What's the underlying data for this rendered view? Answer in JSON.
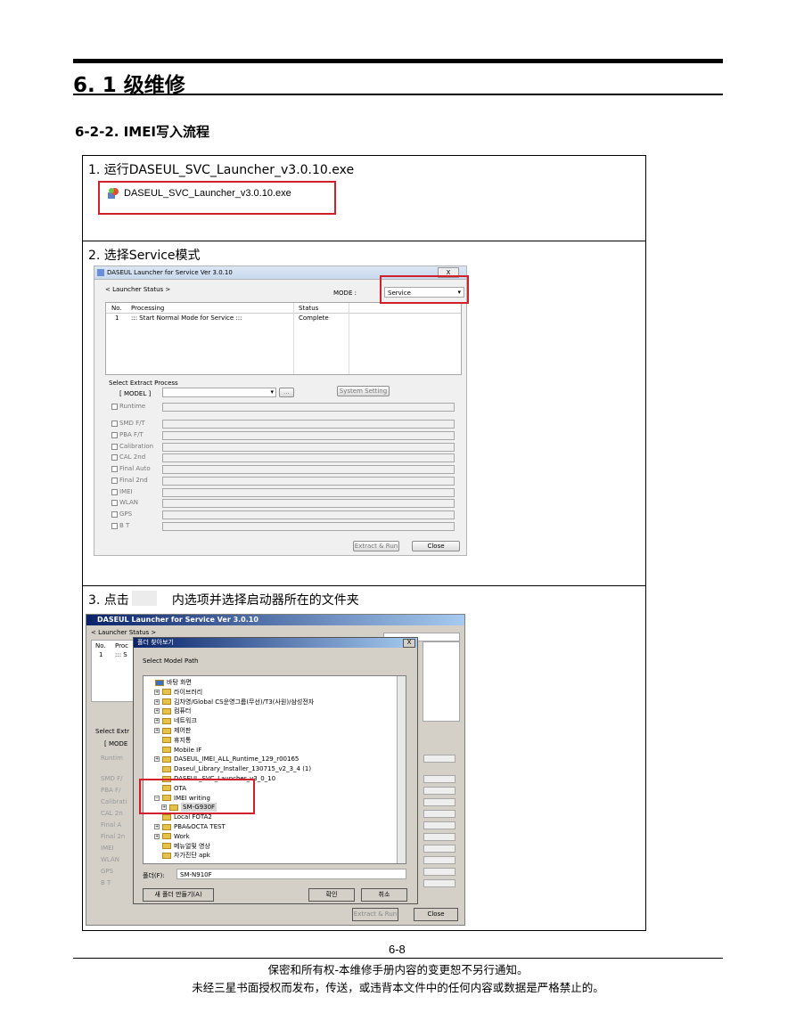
{
  "header": {
    "title": "6. 1 级维修",
    "subtitle": "6-2-2. IMEI写入流程"
  },
  "step1": {
    "text": "1. 运行DASEUL_SVC_Launcher_v3.0.10.exe",
    "file_name": "DASEUL_SVC_Launcher_v3.0.10.exe",
    "icon": "exe-icon"
  },
  "step2": {
    "text": "2. 选择Service模式",
    "window": {
      "title": "DASEUL Launcher for Service Ver 3.0.10",
      "close": "X",
      "launcher_status": "< Launcher Status >",
      "mode_label": "MODE :",
      "mode_value": "Service",
      "columns": [
        "No.",
        "Processing",
        "Status"
      ],
      "rows": [
        [
          "1",
          "::: Start Normal Mode for Service :::",
          "Complete"
        ]
      ],
      "extract_label": "Select Extract Process",
      "model_label": "[ MODEL ]",
      "browse": "...",
      "system_setting": "System Setting",
      "items": [
        "Runtime",
        "SMD F/T",
        "PBA F/T",
        "Calibration",
        "CAL 2nd",
        "Final Auto",
        "Final 2nd",
        "IMEI",
        "WLAN",
        "GPS",
        "B T"
      ],
      "extract_run": "Extract & Run",
      "close_btn": "Close"
    }
  },
  "step3": {
    "text_before": "3. 点击",
    "text_after": "内选项并选择启动器所在的文件夹",
    "window": {
      "title": "DASEUL Launcher for Service Ver 3.0.10",
      "launcher_status": "< Launcher Status >",
      "col_no": "No.",
      "col_proc": "Proc",
      "row_no": "1",
      "row_proc": "::: S",
      "extract": "Select Extr",
      "model": "[ MODE",
      "items": [
        "Runtim",
        "SMD F/",
        "PBA F/",
        "Calibrati",
        "CAL 2n",
        "Final A",
        "Final 2n",
        "IMEI",
        "WLAN",
        "GPS",
        "B T"
      ],
      "extract_run": "Extract & Run",
      "close_btn": "Close"
    },
    "dialog": {
      "title": "폴더 찾아보기",
      "close": "X",
      "label": "Select Model Path",
      "tree": [
        "바탕 화면",
        "라이브러리",
        "김차영/Global CS운영그룹(무선)/T3(사원)/삼성전자",
        "컴퓨터",
        "네트워크",
        "제어판",
        "휴지통",
        "Mobile IF",
        "DASEUL_IMEI_ALL_Runtime_129_r00165",
        "Daseul_Library_Installer_130715_v2_3_4 (1)",
        "DASEUL_SVC_Launcher_v3_0_10",
        "OTA",
        "IMEI writing",
        "SM-G930F",
        "Local FOTA2",
        "PBA&OCTA TEST",
        "Work",
        "메뉴얼및 영상",
        "자가진단 apk"
      ],
      "folder_label": "폴더(F):",
      "folder_value": "SM-N910F",
      "new_folder": "새 폴더 만들기(A)",
      "ok": "확인",
      "cancel": "취소"
    }
  },
  "footer": {
    "page": "6-8",
    "line1": "保密和所有权-本维修手册内容的变更恕不另行通知。",
    "line2": "未经三星书面授权而发布，传送，或违背本文件中的任何内容或数据是严格禁止的。"
  },
  "colors": {
    "highlight": "#d21f2c"
  }
}
